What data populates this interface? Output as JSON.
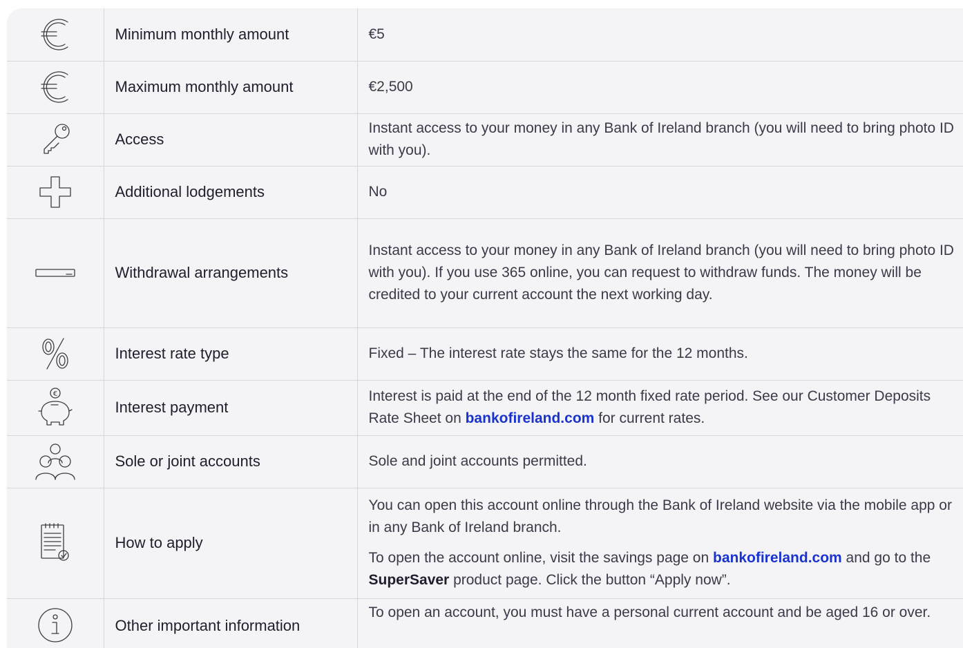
{
  "rows": [
    {
      "icon": "euro-icon",
      "label": "Minimum monthly amount",
      "value": "€5"
    },
    {
      "icon": "euro-icon",
      "label": "Maximum monthly amount",
      "value": "€2,500"
    },
    {
      "icon": "key-icon",
      "label": "Access",
      "value": "Instant access to your money in any Bank of Ireland branch (you will need to bring photo ID with you)."
    },
    {
      "icon": "plus-icon",
      "label": "Additional lodgements",
      "value": "No"
    },
    {
      "icon": "card-icon",
      "label": "Withdrawal arrangements",
      "value": "Instant access to your money in any Bank of Ireland branch (you will need to bring photo ID with you). If you use 365 online, you can request to withdraw funds. The money will be credited to your current account the next working day."
    },
    {
      "icon": "percent-icon",
      "label": "Interest rate type",
      "value": "Fixed – The interest rate stays the same for the 12 months."
    },
    {
      "icon": "piggy-bank-icon",
      "label": "Interest payment",
      "value_before": "Interest is paid at the end of the 12 month fixed rate period. See our Customer Deposits Rate Sheet on ",
      "value_link": "bankofireland.com",
      "value_after": " for current rates."
    },
    {
      "icon": "people-icon",
      "label": "Sole or joint accounts",
      "value": "Sole and joint accounts permitted."
    },
    {
      "icon": "checklist-icon",
      "label": "How to apply",
      "value_p1": "You can open this account online through the Bank of Ireland website via the mobile app or in any Bank of Ireland branch.",
      "value_p2_a": "To open the account online, visit the savings page on ",
      "value_p2_link": "bankofireland.com",
      "value_p2_b": " and go to the ",
      "value_p2_strong": "SuperSaver",
      "value_p2_c": " product page. Click the button “Apply now”."
    },
    {
      "icon": "info-icon",
      "label": "Other important information",
      "value": "To open an account, you must have a personal current account and be aged 16 or over."
    }
  ],
  "colors": {
    "link": "#1a33cc",
    "background": "#f4f4f6",
    "border": "#d6d6dc"
  }
}
